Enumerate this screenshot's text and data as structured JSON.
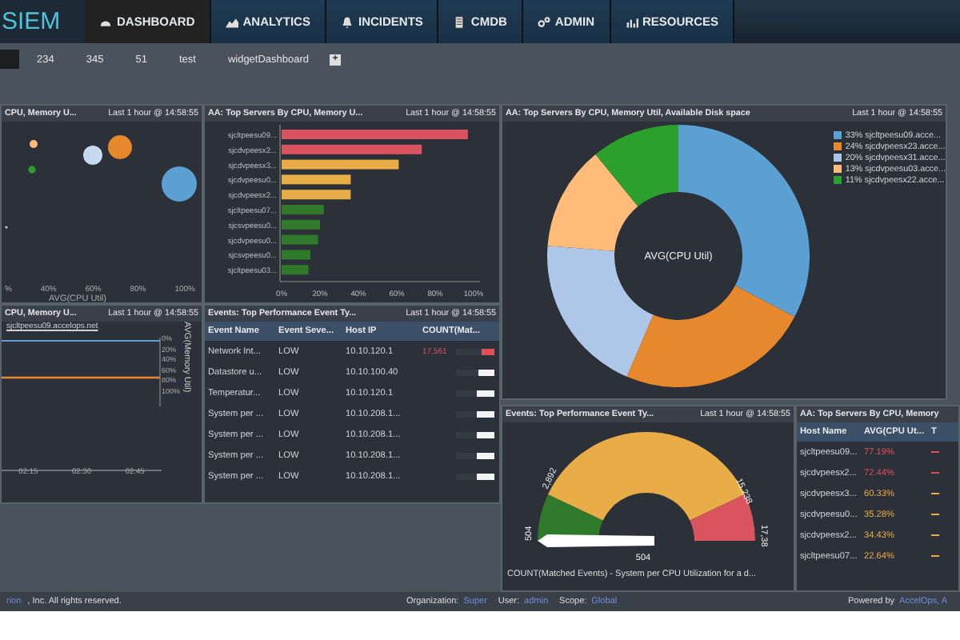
{
  "app": {
    "logo": "SIEM"
  },
  "nav": [
    {
      "label": "DASHBOARD",
      "selected": true
    },
    {
      "label": "ANALYTICS",
      "selected": false
    },
    {
      "label": "INCIDENTS",
      "selected": false
    },
    {
      "label": "CMDB",
      "selected": false
    },
    {
      "label": "ADMIN",
      "selected": false
    },
    {
      "label": "RESOURCES",
      "selected": false
    }
  ],
  "dashboard_tabs": [
    {
      "label": "234",
      "selected": false
    },
    {
      "label": "345",
      "selected": false
    },
    {
      "label": "51",
      "selected": false
    },
    {
      "label": "test",
      "selected": false
    },
    {
      "label": "widgetDashboard",
      "selected": false
    }
  ],
  "add_tab": "+",
  "bubble_panel": {
    "title": "CPU, Memory U...",
    "time": "Last 1 hour @ 14:58:55",
    "x_ticks": [
      "%",
      "40%",
      "60%",
      "80%",
      "100%"
    ],
    "xlabel": "AVG(CPU Util)"
  },
  "bar_panel": {
    "title": "AA: Top Servers By CPU, Memory U...",
    "time": "Last 1 hour @ 14:58:55",
    "chart_data": {
      "type": "bar",
      "orientation": "horizontal",
      "categories": [
        "sjcltpeesu09...",
        "sjcdvpeesx2...",
        "sjcdvpeesx3...",
        "sjcdvpeesu0...",
        "sjcdvpeesx2...",
        "sjcltpeesu07...",
        "sjcsvpeesu0...",
        "sjcdvpeesu0...",
        "sjcsvpeesu0...",
        "sjcltpeesu03..."
      ],
      "values": [
        97,
        73,
        61,
        36,
        36,
        22,
        20,
        19,
        15,
        14
      ],
      "xlim": [
        0,
        100
      ],
      "xticks": [
        {
          "value": 0,
          "label": "0%"
        },
        {
          "value": 20,
          "label": "20%"
        },
        {
          "value": 40,
          "label": "40%"
        },
        {
          "value": 60,
          "label": "60%"
        },
        {
          "value": 80,
          "label": "80%"
        },
        {
          "value": 100,
          "label": "100%"
        }
      ]
    }
  },
  "donut_panel": {
    "title": "AA: Top Servers By CPU, Memory Util, Available Disk space",
    "time": "Last 1 hour @ 14:58:55",
    "chart_data": {
      "type": "donut",
      "title": "AVG(CPU Util)",
      "categories": [
        "33% sjcltpeesu09.acce...",
        "24% sjcdvpeesx23.acce...",
        "20% sjcdvpeesx31.acce...",
        "13% sjcdvpeesu03.acce...",
        "11% sjcdvpeesx22.acce..."
      ],
      "values": [
        33,
        24,
        20,
        13,
        11
      ]
    }
  },
  "line_panel": {
    "title": "CPU, Memory U...",
    "time": "Last 1 hour @ 14:58:55",
    "legend": "sjcltpeesu09.accelops.net",
    "y_ticks": [
      "0%",
      "20%",
      "40%",
      "60%",
      "80%",
      "100%"
    ],
    "ylabel": "AVG(Memory Util)",
    "x_ticks": [
      "02:15",
      "02:30",
      "02:45"
    ]
  },
  "events_panel": {
    "title": "Events: Top Performance Event Ty...",
    "time": "Last 1 hour @ 14:58:55",
    "columns": [
      "Event Name",
      "Event Seve...",
      "Host IP",
      "COUNT(Mat..."
    ],
    "rows": [
      {
        "name": "Network Int...",
        "severity": "LOW",
        "ip": "10.10.120.1",
        "count": "17,561",
        "level": 0.35,
        "kind": "high"
      },
      {
        "name": "Datastore u...",
        "severity": "LOW",
        "ip": "10.10.100.40",
        "level": 0.4,
        "kind": "normal"
      },
      {
        "name": "Temperatur...",
        "severity": "LOW",
        "ip": "10.10.120.1",
        "level": 0.45,
        "kind": "normal"
      },
      {
        "name": "System per ...",
        "severity": "LOW",
        "ip": "10.10.208.1...",
        "level": 0.45,
        "kind": "normal"
      },
      {
        "name": "System per ...",
        "severity": "LOW",
        "ip": "10.10.208.1...",
        "level": 0.45,
        "kind": "normal"
      },
      {
        "name": "System per ...",
        "severity": "LOW",
        "ip": "10.10.208.1...",
        "level": 0.45,
        "kind": "normal"
      },
      {
        "name": "System per ...",
        "severity": "LOW",
        "ip": "10.10.208.1...",
        "level": 0.45,
        "kind": "normal"
      }
    ]
  },
  "gauge_panel": {
    "title": "Events: Top Performance Event Ty...",
    "time": "Last 1 hour @ 14:58:55",
    "min": "504",
    "green_to": "2,892",
    "orange_to": "15,238",
    "max": "17,38",
    "value": "504",
    "caption": "COUNT(Matched Events) - System per CPU Utilization for a d..."
  },
  "servers_panel": {
    "title": "AA: Top Servers By CPU, Memory",
    "columns": [
      "Host Name",
      "AVG(CPU Ut...",
      "T"
    ],
    "rows": [
      {
        "host": "sjcltpeesu09...",
        "cpu": "77.19%",
        "color": "#e0505a"
      },
      {
        "host": "sjcdvpeesx2...",
        "cpu": "72.44%",
        "color": "#e0505a"
      },
      {
        "host": "sjcdvpeesx3...",
        "cpu": "60.33%",
        "color": "#e8ad47"
      },
      {
        "host": "sjcdvpeesu0...",
        "cpu": "35.28%",
        "color": "#e8ad47"
      },
      {
        "host": "sjcdvpeesx2...",
        "cpu": "34.43%",
        "color": "#e8ad47"
      },
      {
        "host": "sjcltpeesu07...",
        "cpu": "22.64%",
        "color": "#e8ad47"
      }
    ]
  },
  "footer": {
    "company_link": "rion",
    "copyright": ", Inc. All rights reserved.",
    "org_label": "Organization:",
    "org": "Super",
    "user_label": "User:",
    "user": "admin",
    "scope_label": "Scope:",
    "scope": "Global",
    "powered_label": "Powered by",
    "powered": "AccelOps, A"
  }
}
